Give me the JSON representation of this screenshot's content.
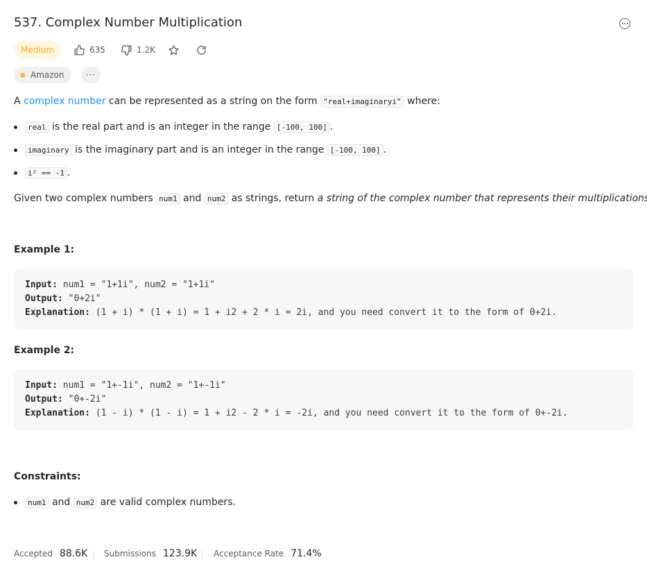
{
  "problem": {
    "title": "537. Complex Number Multiplication",
    "difficulty": "Medium",
    "likes": "635",
    "dislikes": "1.2K",
    "company_tag": "Amazon",
    "more_tags": "···"
  },
  "description": {
    "intro_prefix": "A ",
    "intro_link": "complex number",
    "intro_mid": " can be represented as a string on the form ",
    "intro_form": "\"real+imaginaryi\"",
    "intro_suffix": " where:",
    "bullets": [
      {
        "code": "real",
        "text": " is the real part and is an integer in the range ",
        "range": "[-100, 100]",
        "end": "."
      },
      {
        "code": "imaginary",
        "text": " is the imaginary part and is an integer in the range ",
        "range": "[-100, 100]",
        "end": "."
      },
      {
        "code": "i² == -1",
        "end": "."
      }
    ],
    "given_prefix": "Given two complex numbers ",
    "given_num1": "num1",
    "given_and": " and ",
    "given_num2": "num2",
    "given_mid": " as strings, return ",
    "given_em": "a string of the complex number that represents their multiplications",
    "given_end": "."
  },
  "examples": [
    {
      "heading": "Example 1:",
      "input_label": "Input:",
      "input": " num1 = \"1+1i\", num2 = \"1+1i\"",
      "output_label": "Output:",
      "output": " \"0+2i\"",
      "explanation_label": "Explanation:",
      "explanation": " (1 + i) * (1 + i) = 1 + i2 + 2 * i = 2i, and you need convert it to the form of 0+2i."
    },
    {
      "heading": "Example 2:",
      "input_label": "Input:",
      "input": " num1 = \"1+-1i\", num2 = \"1+-1i\"",
      "output_label": "Output:",
      "output": " \"0+-2i\"",
      "explanation_label": "Explanation:",
      "explanation": " (1 - i) * (1 - i) = 1 + i2 - 2 * i = -2i, and you need convert it to the form of 0+-2i."
    }
  ],
  "constraints": {
    "heading": "Constraints:",
    "num1": "num1",
    "and": " and ",
    "num2": "num2",
    "text": " are valid complex numbers."
  },
  "stats": {
    "accepted_label": "Accepted",
    "accepted": "88.6K",
    "submissions_label": "Submissions",
    "submissions": "123.9K",
    "rate_label": "Acceptance Rate",
    "rate": "71.4%"
  },
  "colors": {
    "accent_link": "#1a90ff",
    "difficulty_medium": "#ffa116",
    "difficulty_bg": "#fff7e0",
    "amazon_orange": "#ff9900"
  },
  "icons": [
    "thumbs-up-icon",
    "thumbs-down-icon",
    "star-icon",
    "share-icon",
    "more-options-icon",
    "amazon-logo-icon"
  ]
}
